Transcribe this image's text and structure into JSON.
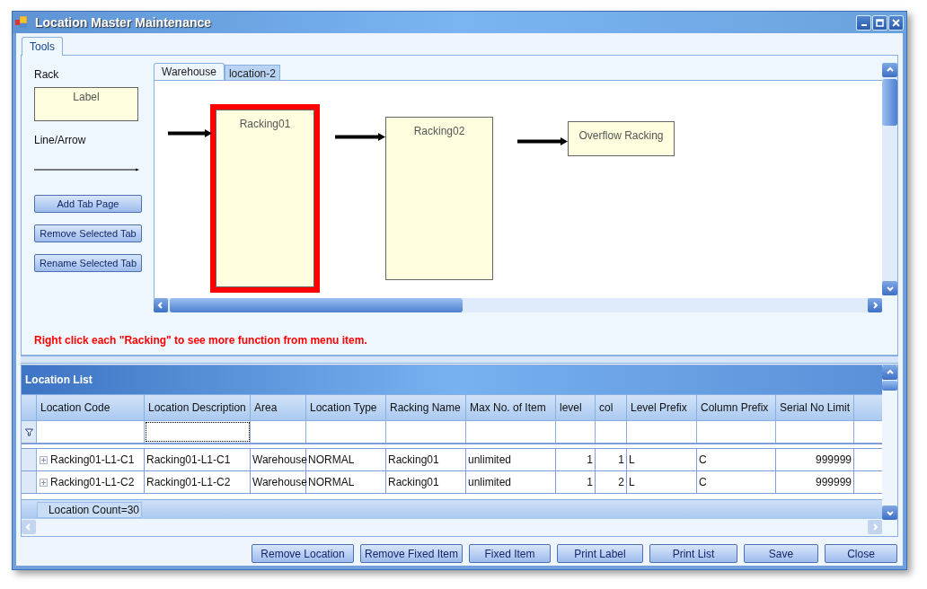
{
  "window": {
    "title": "Location Master Maintenance"
  },
  "outer_tabs": [
    {
      "label": "Tools",
      "selected": true
    }
  ],
  "tools": {
    "rack_label": "Rack",
    "rack_sample": "Label",
    "line_label": "Line/Arrow",
    "buttons": [
      "Add Tab Page",
      "Remove Selected Tab",
      "Rename Selected Tab"
    ]
  },
  "canvas_tabs": [
    {
      "label": "Warehouse",
      "selected": true
    },
    {
      "label": "location-2",
      "selected": false
    }
  ],
  "racks": [
    {
      "label": "Racking01",
      "selected": true
    },
    {
      "label": "Racking02",
      "selected": false
    },
    {
      "label": "Overflow Racking",
      "selected": false
    }
  ],
  "hint": "Right click each \"Racking\" to see more function from menu item.",
  "location_list": {
    "title": "Location List",
    "columns": [
      {
        "label": "Location Code",
        "kind": "text"
      },
      {
        "label": "Location Description",
        "kind": "text"
      },
      {
        "label": "Area",
        "kind": "text"
      },
      {
        "label": "Location Type",
        "kind": "text"
      },
      {
        "label": "Racking Name",
        "kind": "text"
      },
      {
        "label": "Max No. of Item",
        "kind": "text"
      },
      {
        "label": "level",
        "kind": "number"
      },
      {
        "label": "col",
        "kind": "number"
      },
      {
        "label": "Level Prefix",
        "kind": "text"
      },
      {
        "label": "Column Prefix",
        "kind": "text"
      },
      {
        "label": "Serial No Limit",
        "kind": "number"
      }
    ],
    "rows": [
      [
        "Racking01-L1-C1",
        "Racking01-L1-C1",
        "Warehouse",
        "NORMAL",
        "Racking01",
        "unlimited",
        "1",
        "1",
        "L",
        "C",
        "999999"
      ],
      [
        "Racking01-L1-C2",
        "Racking01-L1-C2",
        "Warehouse",
        "NORMAL",
        "Racking01",
        "unlimited",
        "1",
        "2",
        "L",
        "C",
        "999999"
      ]
    ],
    "footer": "Location Count=30"
  },
  "buttons": [
    "Remove Location",
    "Remove Fixed Item",
    "Fixed Item",
    "Print Label",
    "Print List",
    "Save",
    "Close"
  ]
}
